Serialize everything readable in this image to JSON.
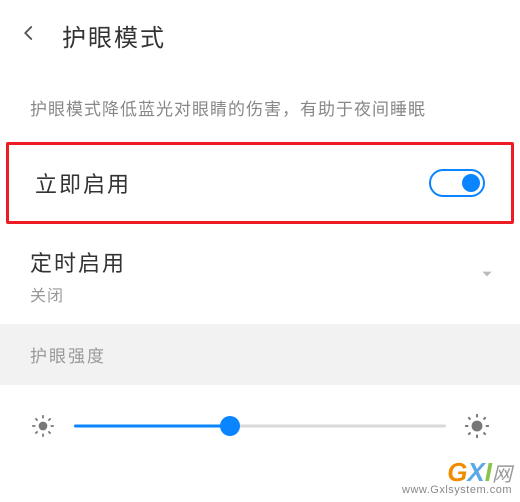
{
  "header": {
    "title": "护眼模式"
  },
  "description": "护眼模式降低蓝光对眼睛的伤害，有助于夜间睡眠",
  "enable_now": {
    "label": "立即启用",
    "on": true
  },
  "scheduled": {
    "label": "定时启用",
    "status": "关闭"
  },
  "intensity": {
    "section_label": "护眼强度",
    "value_percent": 42
  },
  "watermark": {
    "brand": "GXI",
    "suffix": "网",
    "url": "www.Gxlsystem.com"
  },
  "colors": {
    "accent": "#0a84ff",
    "highlight_border": "#ed1c24"
  }
}
